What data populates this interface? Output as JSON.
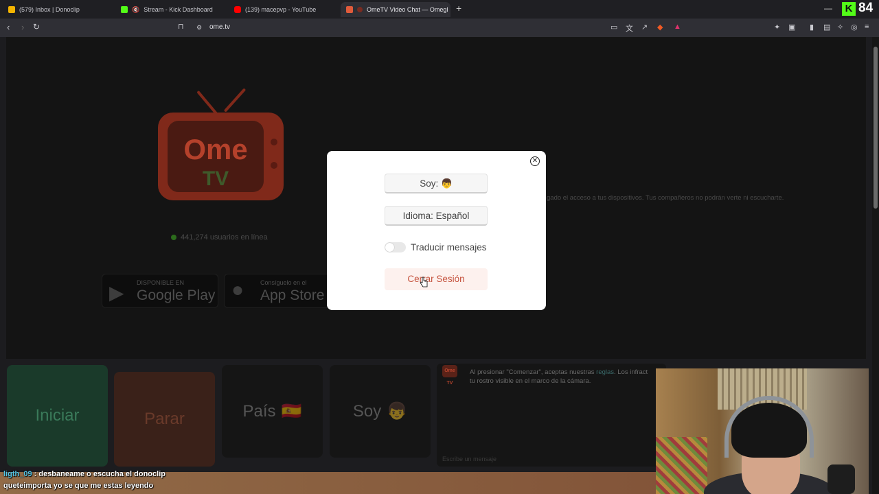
{
  "browser": {
    "tabs": [
      {
        "title": "(579) Inbox | Donoclip",
        "color": "#f4b400"
      },
      {
        "title": "Stream - Kick Dashboard",
        "color": "#53fc18"
      },
      {
        "title": "(139) macepvp - YouTube",
        "color": "#ff0000"
      },
      {
        "title": "OmeTV Video Chat — Omegl",
        "color": "#e05b3b"
      }
    ],
    "new_tab": "+",
    "url": "ome.tv"
  },
  "overlay": {
    "kick_logo": "K",
    "kick_count": "84",
    "chat": [
      {
        "user": "ligth_09",
        "text": " : desbaneame o escucha el donoclip"
      },
      {
        "user": "",
        "text": "queteimporta yo se que me estas leyendo"
      }
    ]
  },
  "page": {
    "logo_top": "Ome",
    "logo_bottom": "TV",
    "online_count": "441,274 usuarios en línea",
    "google_play_small": "DISPONIBLE EN",
    "google_play_big": "Google Play",
    "app_store_small": "Consíguelo en el",
    "app_store_big": "App Store",
    "bg_notice": "gado el acceso a tus dispositivos. Tus compañeros no podrán verte ni escucharte.",
    "buttons": {
      "start": "Iniciar",
      "stop": "Parar",
      "country": "País",
      "country_flag": "🇪🇸",
      "gender": "Soy",
      "gender_emoji": "👦"
    },
    "chat_logo": "Ome TV",
    "chat_notice_1": "Al presionar \"Comenzar\", aceptas nuestras ",
    "chat_notice_link": "reglas",
    "chat_notice_2": ". Los infract",
    "chat_notice_3": "tu rostro visible en el marco de la cámara.",
    "chat_placeholder": "Escribe un mensaje"
  },
  "modal": {
    "soy_label": "Soy: 👦",
    "language_label": "Idioma: Español",
    "translate_label": "Traducir mensajes",
    "translate_on": false,
    "logout_label": "Cerrar Sesión"
  },
  "colors": {
    "accent": "#c5523d",
    "kick_green": "#53fc18"
  }
}
